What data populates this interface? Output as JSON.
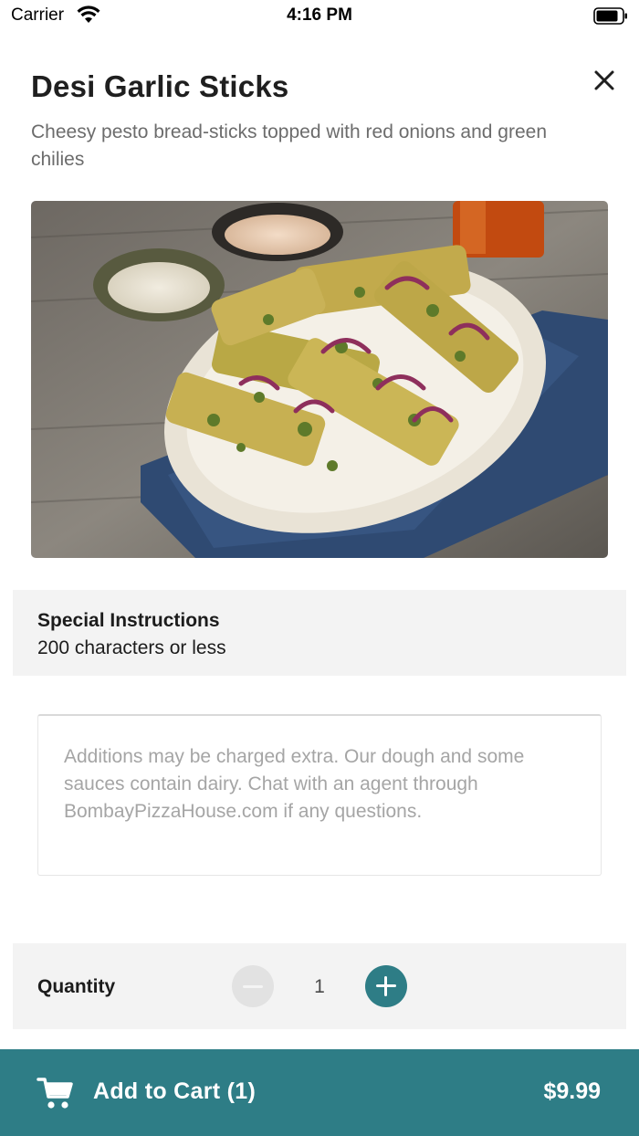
{
  "status_bar": {
    "carrier": "Carrier",
    "time": "4:16 PM"
  },
  "item": {
    "title": "Desi Garlic Sticks",
    "description": "Cheesy pesto bread-sticks topped with red onions and green chilies"
  },
  "special_instructions": {
    "title": "Special Instructions",
    "subtitle": "200 characters or less",
    "placeholder": "Additions may be charged extra. Our dough and some sauces contain dairy. Chat with an agent through BombayPizzaHouse.com if any questions."
  },
  "quantity": {
    "label": "Quantity",
    "value": "1"
  },
  "cart": {
    "label": "Add to Cart (1)",
    "price": "$9.99"
  },
  "colors": {
    "accent": "#2e7d86",
    "section_bg": "#f3f3f3",
    "disabled": "#e2e2e2"
  }
}
